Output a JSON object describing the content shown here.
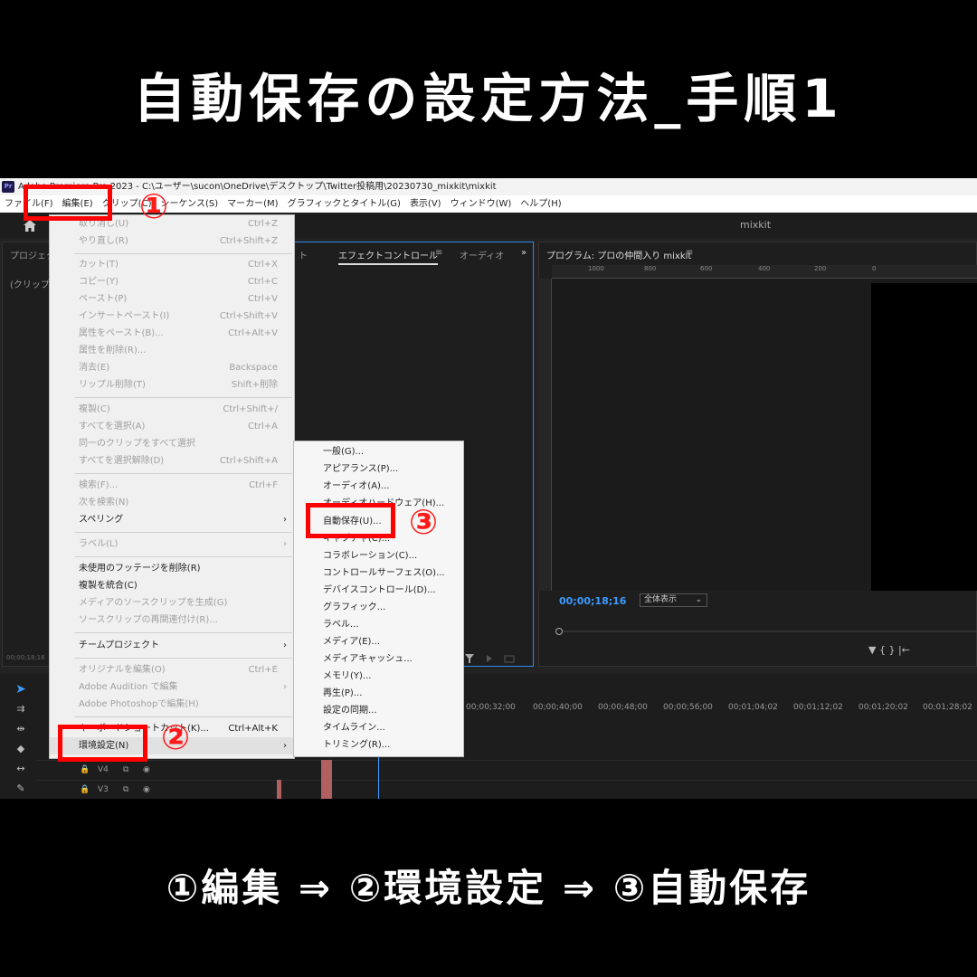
{
  "title": "自動保存の設定方法_手順1",
  "caption": "①編集 ⇒ ②環境設定 ⇒ ③自動保存",
  "window": {
    "logo": "Pr",
    "title_bar": "Adobe Premiere Pro 2023 - C:\\ユーザー\\sucon\\OneDrive\\デスクトップ\\Twitter投稿用\\20230730_mixkit\\mixkit",
    "workspace": "mixkit"
  },
  "menubar": [
    "ファイル(F)",
    "編集(E)",
    "クリップ(C)",
    "シーケンス(S)",
    "マーカー(M)",
    "グラフィックとタイトル(G)",
    "表示(V)",
    "ウィンドウ(W)",
    "ヘルプ(H)"
  ],
  "panels": {
    "project_tab": "プロジェクト",
    "project_sub": "(クリップが",
    "project_time": "00;00;18;16",
    "effect_tab_prev": "ト",
    "effect_tab": "エフェクトコントロール",
    "effect_menu": "≡",
    "audio_tab": "オーディオ",
    "more": "»",
    "program_tab": "プログラム: プロの仲間入り mixkit",
    "program_menu": "≡",
    "ruler_marks": [
      "1000",
      "800",
      "600",
      "400",
      "200",
      "0"
    ],
    "timecode": "00;00;18;16",
    "zoom": "全体表示",
    "transport": "▼  {  }  |←"
  },
  "timeline": {
    "times": [
      "00;00;32;00",
      "00;00;40;00",
      "00;00;48;00",
      "00;00;56;00",
      "00;01;04;02",
      "00;01;12;02",
      "00;01;20;02",
      "00;01;28;02"
    ],
    "tracks": [
      "V4",
      "V3"
    ]
  },
  "edit_menu": {
    "items": [
      {
        "label": "取り消し(U)",
        "shortcut": "Ctrl+Z",
        "disabled": true
      },
      {
        "label": "やり直し(R)",
        "shortcut": "Ctrl+Shift+Z",
        "disabled": true
      },
      {
        "label": "カット(T)",
        "shortcut": "Ctrl+X",
        "disabled": true
      },
      {
        "label": "コピー(Y)",
        "shortcut": "Ctrl+C",
        "disabled": true
      },
      {
        "label": "ペースト(P)",
        "shortcut": "Ctrl+V",
        "disabled": true
      },
      {
        "label": "インサートペースト(I)",
        "shortcut": "Ctrl+Shift+V",
        "disabled": true
      },
      {
        "label": "属性をペースト(B)...",
        "shortcut": "Ctrl+Alt+V",
        "disabled": true
      },
      {
        "label": "属性を削除(R)...",
        "shortcut": "",
        "disabled": true
      },
      {
        "label": "消去(E)",
        "shortcut": "Backspace",
        "disabled": true
      },
      {
        "label": "リップル削除(T)",
        "shortcut": "Shift+削除",
        "disabled": true
      },
      {
        "label": "複製(C)",
        "shortcut": "Ctrl+Shift+/",
        "disabled": true
      },
      {
        "label": "すべてを選択(A)",
        "shortcut": "Ctrl+A",
        "disabled": true
      },
      {
        "label": "同一のクリップをすべて選択",
        "shortcut": "",
        "disabled": true
      },
      {
        "label": "すべてを選択解除(D)",
        "shortcut": "Ctrl+Shift+A",
        "disabled": true
      },
      {
        "label": "検索(F)...",
        "shortcut": "Ctrl+F",
        "disabled": true
      },
      {
        "label": "次を検索(N)",
        "shortcut": "",
        "disabled": true
      },
      {
        "label": "スペリング",
        "shortcut": "",
        "disabled": false
      },
      {
        "label": "ラベル(L)",
        "shortcut": "",
        "disabled": true
      },
      {
        "label": "未使用のフッテージを削除(R)",
        "shortcut": "",
        "disabled": false
      },
      {
        "label": "複製を統合(C)",
        "shortcut": "",
        "disabled": false
      },
      {
        "label": "メディアのソースクリップを生成(G)",
        "shortcut": "",
        "disabled": true
      },
      {
        "label": "ソースクリップの再関連付け(R)...",
        "shortcut": "",
        "disabled": true
      },
      {
        "label": "チームプロジェクト",
        "shortcut": "",
        "disabled": false
      },
      {
        "label": "オリジナルを編集(O)",
        "shortcut": "Ctrl+E",
        "disabled": true
      },
      {
        "label": "Adobe Audition で編集",
        "shortcut": "",
        "disabled": true
      },
      {
        "label": "Adobe Photoshopで編集(H)",
        "shortcut": "",
        "disabled": true
      },
      {
        "label": "キーボードショートカット(K)...",
        "shortcut": "Ctrl+Alt+K",
        "disabled": false
      },
      {
        "label": "環境設定(N)",
        "shortcut": "",
        "disabled": false
      }
    ],
    "arrow": "›"
  },
  "prefs_menu": {
    "items": [
      "一般(G)...",
      "アピアランス(P)...",
      "オーディオ(A)...",
      "オーディオハードウェア(H)...",
      "自動保存(U)...",
      "キャプチャ(C)...",
      "コラボレーション(C)...",
      "コントロールサーフェス(O)...",
      "デバイスコントロール(D)...",
      "グラフィック...",
      "ラベル...",
      "メディア(E)...",
      "メディアキャッシュ...",
      "メモリ(Y)...",
      "再生(P)...",
      "設定の同期...",
      "タイムライン...",
      "トリミング(R)..."
    ]
  },
  "steps": [
    "①",
    "②",
    "③"
  ],
  "colors": {
    "highlight": "#ff0000",
    "accent": "#3d9bff",
    "background": "#000000"
  }
}
